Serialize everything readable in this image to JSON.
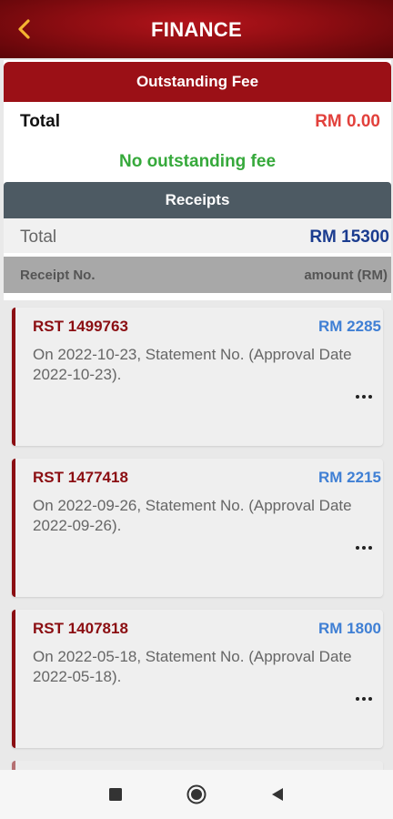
{
  "header": {
    "title": "FINANCE",
    "back_icon": "chevron-left-icon",
    "accent": "#f5b431"
  },
  "outstanding": {
    "title": "Outstanding Fee",
    "total_label": "Total",
    "total_value": "RM 0.00",
    "status_text": "No outstanding fee"
  },
  "receipts": {
    "title": "Receipts",
    "total_label": "Total",
    "total_value": "RM 15300",
    "columns": {
      "receipt_no": "Receipt No.",
      "amount": "amount (RM)"
    },
    "items": [
      {
        "no": "RST 1499763",
        "amount": "RM 2285",
        "desc": "On 2022-10-23, Statement No.  (Approval Date 2022-10-23).",
        "more": "..."
      },
      {
        "no": "RST 1477418",
        "amount": "RM 2215",
        "desc": "On 2022-09-26, Statement No.  (Approval Date 2022-09-26).",
        "more": "..."
      },
      {
        "no": "RST 1407818",
        "amount": "RM 1800",
        "desc": "On 2022-05-18, Statement No.  (Approval Date 2022-05-18).",
        "more": "..."
      }
    ]
  },
  "navbar": {
    "icons": [
      "square-icon",
      "circle-icon",
      "triangle-back-icon"
    ]
  }
}
